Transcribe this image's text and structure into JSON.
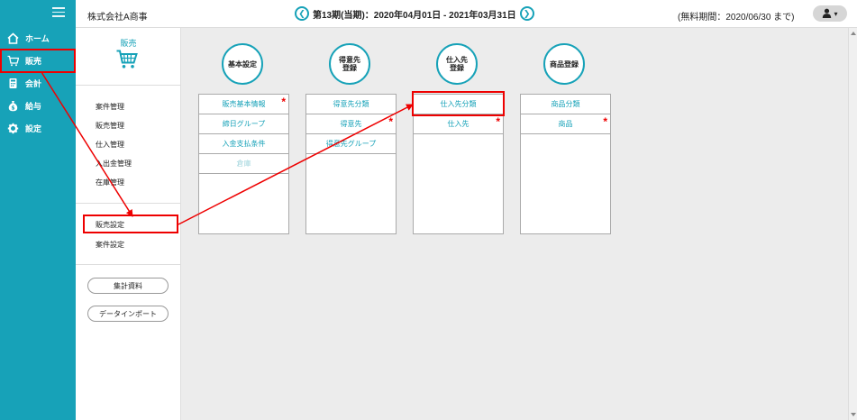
{
  "nav": {
    "items": [
      {
        "id": "home",
        "label": "ホーム",
        "icon": "home-icon"
      },
      {
        "id": "sales",
        "label": "販売",
        "icon": "cart-icon"
      },
      {
        "id": "accounting",
        "label": "会計",
        "icon": "calculator-icon"
      },
      {
        "id": "payroll",
        "label": "給与",
        "icon": "money-bag-icon"
      },
      {
        "id": "settings",
        "label": "設定",
        "icon": "gear-icon"
      }
    ]
  },
  "header": {
    "company": "株式会社A商事",
    "prev_label": "❮",
    "next_label": "❯",
    "period": "第13期(当期)：2020年04月01日 - 2021年03月31日",
    "trial": "(無料期間：2020/06/30 まで)",
    "user_caret": "▾"
  },
  "subnav": {
    "title": "販売",
    "links": [
      "案件管理",
      "販売管理",
      "仕入管理",
      "入出金管理",
      "在庫管理"
    ],
    "settings_links": [
      "販売設定",
      "案件設定"
    ],
    "buttons": [
      "集計資料",
      "データインポート"
    ]
  },
  "cards": [
    {
      "title": "基本設定",
      "rows": [
        {
          "label": "販売基本情報",
          "required": true,
          "disabled": false
        },
        {
          "label": "締日グループ",
          "required": false,
          "disabled": false
        },
        {
          "label": "入金支払条件",
          "required": false,
          "disabled": false
        },
        {
          "label": "倉庫",
          "required": false,
          "disabled": true
        }
      ]
    },
    {
      "title": "得意先\n登録",
      "rows": [
        {
          "label": "得意先分類",
          "required": false,
          "disabled": false
        },
        {
          "label": "得意先",
          "required": true,
          "disabled": false
        },
        {
          "label": "得意先グループ",
          "required": false,
          "disabled": false
        }
      ]
    },
    {
      "title": "仕入先\n登録",
      "rows": [
        {
          "label": "仕入先分類",
          "required": false,
          "disabled": false
        },
        {
          "label": "仕入先",
          "required": true,
          "disabled": false
        }
      ]
    },
    {
      "title": "商品登録",
      "rows": [
        {
          "label": "商品分類",
          "required": false,
          "disabled": false
        },
        {
          "label": "商品",
          "required": true,
          "disabled": false
        }
      ]
    }
  ],
  "required_mark": "*",
  "colors": {
    "accent": "#17a2b8",
    "highlight": "#e00000",
    "background": "#ececec"
  }
}
